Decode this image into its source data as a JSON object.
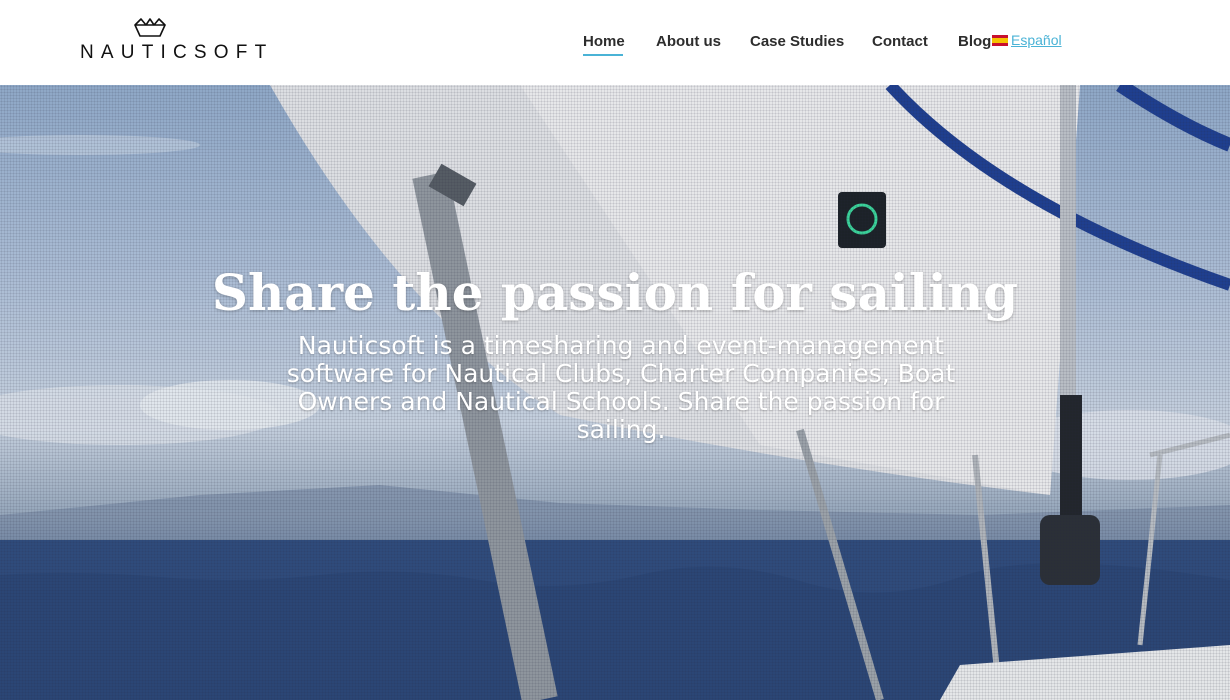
{
  "brand": {
    "name": "NAUTICSOFT",
    "logo_icon": "paper-boat-icon"
  },
  "nav": {
    "items": [
      {
        "label": "Home",
        "active": true
      },
      {
        "label": "About us"
      },
      {
        "label": "Case Studies"
      },
      {
        "label": "Contact"
      },
      {
        "label": "Blog"
      }
    ],
    "language": {
      "label": "Español",
      "icon": "spain-flag-icon"
    }
  },
  "hero": {
    "title": "Share the passion for sailing",
    "subtitle": "Nauticsoft is a timesharing and event-management software for Nautical Clubs, Charter Companies, Boat Owners and Nautical Schools. Share the passion for sailing."
  },
  "colors": {
    "accent": "#4ab3d6",
    "nav_text": "#2d2d2d",
    "hero_text": "#ffffff"
  }
}
